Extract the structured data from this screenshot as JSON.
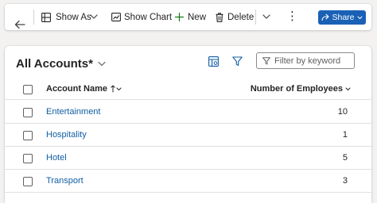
{
  "toolbar": {
    "show_as": "Show As",
    "show_chart": "Show Chart",
    "new": "New",
    "delete": "Delete",
    "more": "⋮",
    "share": "Share"
  },
  "view": {
    "title": "All Accounts*",
    "search_placeholder": "Filter by keyword"
  },
  "table": {
    "columns": [
      "Account Name",
      "Number of Employees"
    ],
    "rows": [
      {
        "name": "Entertainment",
        "employees": "10"
      },
      {
        "name": "Hospitality",
        "employees": "1"
      },
      {
        "name": "Hotel",
        "employees": "5"
      },
      {
        "name": "Transport",
        "employees": "3"
      }
    ]
  },
  "colors": {
    "accent": "#1a61b5",
    "link": "#115ea3",
    "new_icon": "#107c10"
  }
}
